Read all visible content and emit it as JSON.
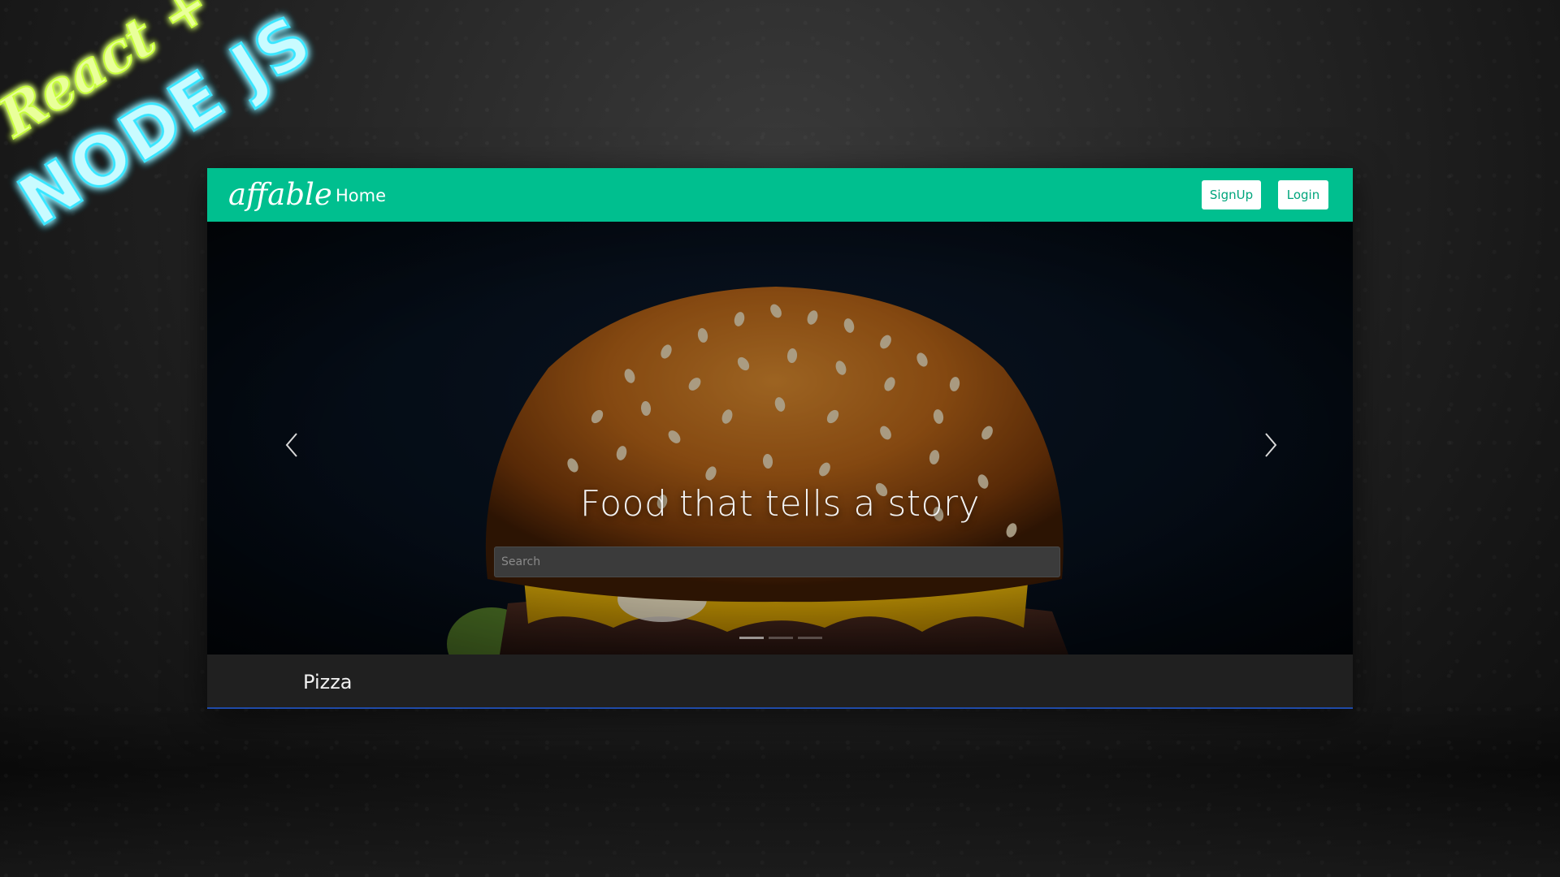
{
  "banner": {
    "line1": "React +",
    "line2": "NODE JS"
  },
  "navbar": {
    "brand": "affable",
    "home_link": "Home",
    "signup_label": "SignUp",
    "login_label": "Login",
    "color": "#00bf8f"
  },
  "hero": {
    "caption": "Food that tells a story",
    "search_placeholder": "Search",
    "slides": 3,
    "active_slide": 1
  },
  "category": {
    "label": "Pizza"
  },
  "icons": {
    "prev": "chevron-left-icon",
    "next": "chevron-right-icon"
  }
}
